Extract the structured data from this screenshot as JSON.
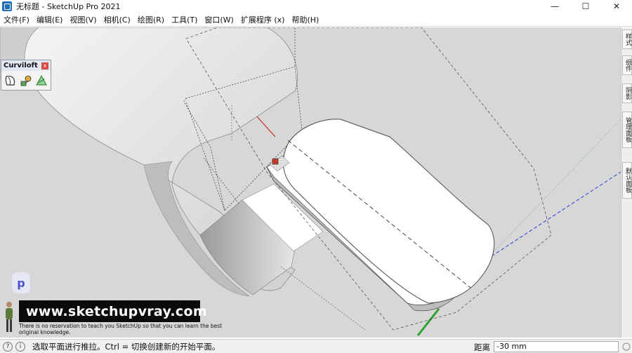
{
  "window": {
    "title": "无标题 - SketchUp Pro 2021",
    "controls": {
      "minimize": "—",
      "maximize": "☐",
      "close": "✕"
    }
  },
  "menu": [
    "文件(F)",
    "编辑(E)",
    "视图(V)",
    "相机(C)",
    "绘图(R)",
    "工具(T)",
    "窗口(W)",
    "扩展程序 (x)",
    "帮助(H)"
  ],
  "toolbar": {
    "title": "Curviloft",
    "close": "x",
    "tools": [
      "loft-by-spline-icon",
      "skin-contours-icon",
      "loft-along-path-icon"
    ]
  },
  "tray": {
    "tabs": [
      "样式",
      "组件",
      "阴影",
      "管理面板",
      "默认面板"
    ]
  },
  "watermark": {
    "logo_letter": "p",
    "site": "www.sketchupvray.com",
    "caption": "There is no reservation to teach you SketchUp so that you can learn the best original knowledge."
  },
  "status": {
    "message": "选取平面进行推拉。Ctrl = 切换创建新的开始平面。",
    "measure_label": "距离",
    "measure_value": "-30 mm"
  },
  "colors": {
    "viewport_bg": "#d7d7d7",
    "axis_red": "#cc2a2a",
    "axis_green": "#2fa12f",
    "axis_blue": "#2a3fd6"
  }
}
